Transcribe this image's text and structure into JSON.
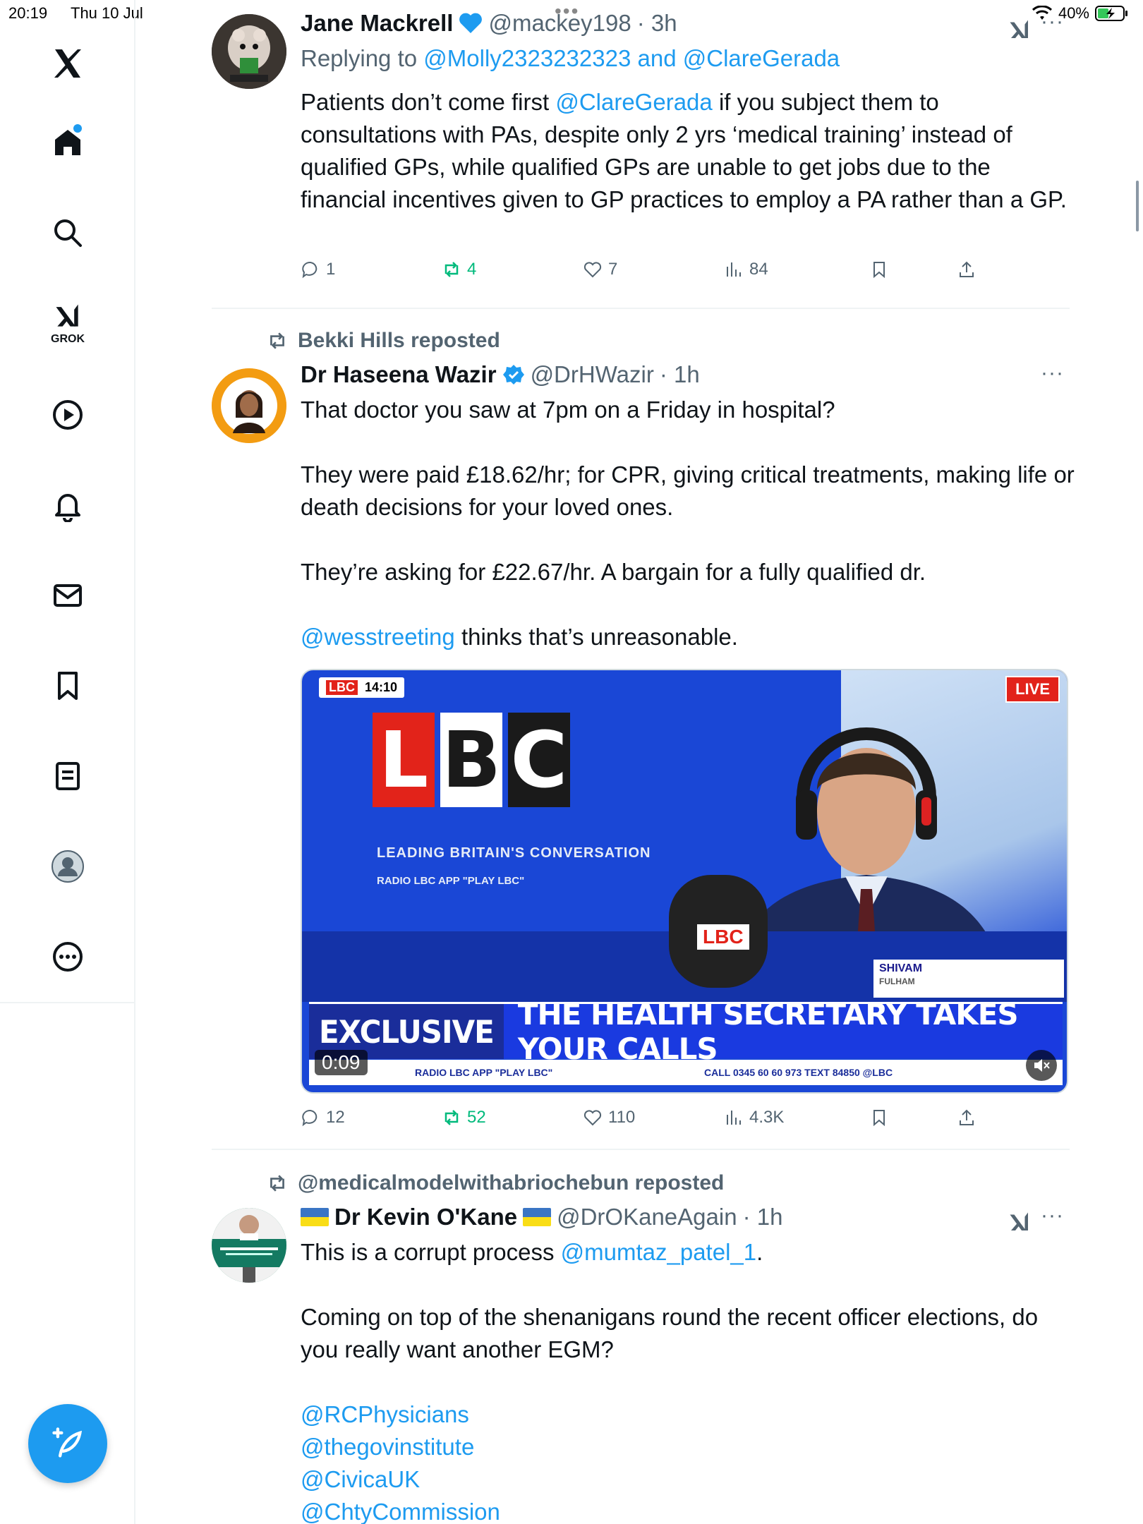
{
  "status_bar": {
    "time": "20:19",
    "date": "Thu 10 Jul",
    "battery": "40%"
  },
  "sidebar": {
    "grok_label": "GROK",
    "items": [
      "X home",
      "Home",
      "Search",
      "Grok",
      "Videos",
      "Notifications",
      "Messages",
      "Bookmarks",
      "Lists",
      "Profile",
      "More"
    ]
  },
  "tweets": [
    {
      "name": "Jane Mackrell",
      "handle": "@mackey198",
      "time": "· 3h",
      "reply_prefix": "Replying to",
      "reply_handle_1": "@Molly2323232323",
      "reply_and": "and",
      "reply_handle_2": "@ClareGerada",
      "text_start": "Patients don’t come first",
      "text_mention": "@ClareGerada",
      "text_rest": "if you subject them to consultations with PAs, despite only 2 yrs ‘medical training’ instead of qualified GPs, while qualified GPs are unable to get jobs due to the financial incentives given to GP practices to employ a PA rather than a GP.",
      "replies": "1",
      "reposts": "4",
      "likes": "7",
      "views": "84"
    },
    {
      "reposted_by": "Bekki Hills reposted",
      "name": "Dr Haseena Wazir",
      "handle": "@DrHWazir",
      "time": "· 1h",
      "para1": "That doctor you saw at 7pm on a Friday in hospital?",
      "para2": "They were paid £18.62/hr; for CPR, giving critical treatments, making life or death decisions for your loved ones.",
      "para3": "They’re asking for £22.67/hr. A bargain for a fully qualified dr.",
      "para4_mention": "@wesstreeting",
      "para4_rest": "thinks that’s unreasonable.",
      "video": {
        "corner_logo": "LBC",
        "corner_time": "14:10",
        "live": "LIVE",
        "logo_letters": [
          "L",
          "B",
          "C"
        ],
        "tagline": "LEADING BRITAIN'S CONVERSATION",
        "platforms": "RADIO   LBC APP   \"PLAY LBC\"",
        "mic_label": "LBC",
        "caller_name": "SHIVAM",
        "caller_place": "FULHAM",
        "exclusive": "EXCLUSIVE",
        "headline": "THE HEALTH SECRETARY TAKES YOUR CALLS",
        "ticker_left": "RADIO   LBC APP   \"PLAY LBC\"",
        "ticker_right": "CALL 0345 60 60 973   TEXT 84850   @LBC",
        "duration": "0:09"
      },
      "replies": "12",
      "reposts": "52",
      "likes": "110",
      "views": "4.3K"
    },
    {
      "reposted_by": "@medicalmodelwithabriochebun reposted",
      "name": "Dr Kevin O'Kane",
      "handle": "@DrOKaneAgain",
      "time": "· 1h",
      "line1_start": "This is a corrupt process",
      "line1_mention": "@mumtaz_patel_1",
      "line1_end": ".",
      "para2": "Coming on top of the shenanigans round the recent officer elections, do you really want another EGM?",
      "mentions": [
        "@RCPhysicians",
        "@thegovinstitute",
        "@CivicaUK",
        "@ChtyCommission"
      ]
    }
  ],
  "colors": {
    "accent": "#1d9bf0",
    "repost_green": "#00ba7c",
    "muted": "#536471"
  }
}
